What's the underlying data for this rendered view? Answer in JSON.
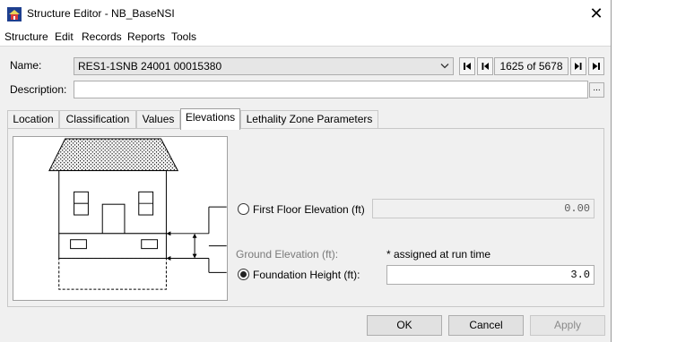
{
  "window": {
    "title": "Structure Editor - NB_BaseNSI",
    "close_glyph": "✕"
  },
  "menu": [
    "Structure",
    "Edit",
    "Records",
    "Reports",
    "Tools"
  ],
  "form": {
    "name_label": "Name:",
    "name_value": "RES1-1SNB 24001 00015380",
    "record_count": "1625 of 5678",
    "description_label": "Description:",
    "description_value": "",
    "description_button": "..."
  },
  "tabs": [
    {
      "label": "Location",
      "active": false
    },
    {
      "label": "Classification",
      "active": false
    },
    {
      "label": "Values",
      "active": false
    },
    {
      "label": "Elevations",
      "active": true
    },
    {
      "label": "Lethality Zone Parameters",
      "active": false
    }
  ],
  "elevations": {
    "first_floor_label": "First Floor Elevation (ft)",
    "first_floor_value": "0.00",
    "first_floor_selected": false,
    "ground_label": "Ground Elevation (ft):",
    "ground_note": "* assigned at run time",
    "foundation_label": "Foundation Height (ft):",
    "foundation_value": "3.0",
    "foundation_selected": true
  },
  "buttons": {
    "ok": "OK",
    "cancel": "Cancel",
    "apply": "Apply"
  }
}
